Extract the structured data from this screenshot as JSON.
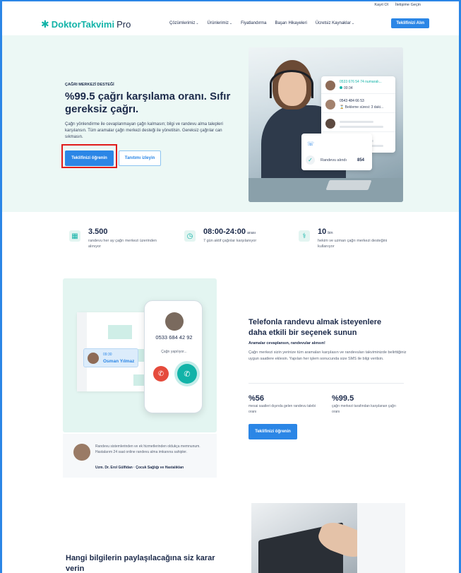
{
  "topbar": {
    "login": "Kayıt Ol",
    "contact": "İletişime Geçin"
  },
  "nav": {
    "logo_brand": "DoktorTakvimi",
    "logo_suffix": "Pro",
    "items": [
      {
        "label": "Çözümlerimiz",
        "dropdown": true
      },
      {
        "label": "Ürünlerimiz",
        "dropdown": true
      },
      {
        "label": "Fiyatlandırma",
        "dropdown": false
      },
      {
        "label": "Başarı Hikayeleri",
        "dropdown": false
      },
      {
        "label": "Ücretsiz Kaynaklar",
        "dropdown": true
      }
    ],
    "cta": "Teklifinizi Alın"
  },
  "hero": {
    "eyebrow": "ÇAĞRI MERKEZİ DESTEĞİ",
    "title": "%99.5 çağrı karşılama oranı. Sıfır gereksiz çağrı.",
    "description": "Çağrı yönlendirme ile cevaplanmayan çağrı kalmasın; bilgi ve randevu alma talepleri karşılansın. Tüm aramalar çağrı merkezi desteği ile yönetilsin. Gereksiz çağrılar can sıkmasın.",
    "primary_button": "Teklifinizi öğrenin",
    "secondary_button": "Tanıtımı izleyin",
    "call_card": {
      "row1_phone": "0533 676 54 74 numaralı...",
      "row1_timer": "00:34",
      "row2_phone": "0543 484 66 53",
      "row2_status": "Bekleme süresi: 3 daki..."
    },
    "mini_card": {
      "label": "Randevu alındı",
      "value": "854"
    }
  },
  "stats": [
    {
      "value": "3.500",
      "suffix": "",
      "desc": "randevu her ay çağrı merkezi üzerinden alınıyor",
      "icon": "calendar-icon"
    },
    {
      "value": "08:00-24:00",
      "suffix": "arası",
      "desc": "7 gün aktif çağrılar karşılanıyor",
      "icon": "clock-icon"
    },
    {
      "value": "10",
      "suffix": "bin",
      "desc": "hekim ve uzman çağrı merkezi desteğini kullanıyor",
      "icon": "doctor-icon"
    }
  ],
  "section2": {
    "phone_number": "0533 684 42 92",
    "phone_status": "Çağrı yapılıyor...",
    "caller_time": "09:30",
    "caller_name": "Osman Yılmaz",
    "title": "Telefonla randevu almak isteyenlere daha etkili bir seçenek sunun",
    "subtitle": "Aramalar cevaplansın, randevular alınsın!",
    "description": "Çağrı merkezi sizin yerinize tüm aramaları karşılasın ve randevuları takviminizde belirttiğiniz uygun saatlere eklesin. Yapılan her işlem sonucunda size SMS ile bilgi verilsin.",
    "stat1_value": "%56",
    "stat1_desc": "mesai saatleri dışında gelen randevu talebi oranı",
    "stat2_value": "%99.5",
    "stat2_desc": "çağrı merkezi tarafından karşılanan çağrı oranı",
    "button": "Teklifinizi öğrenin",
    "testimonial_quote": "Randevu sistemlerinden ve ek hizmetlerinden oldukça memnunum. Hastalarım 24 saat online randevu alma imkanına sahipler.",
    "testimonial_author": "Uzm. Dr. Erol Gülfidan · Çocuk Sağlığı ve Hastalıkları"
  },
  "section3": {
    "title": "Hangi bilgilerin paylaşılacağına siz karar verin"
  },
  "colors": {
    "accent": "#2b86e6",
    "brand": "#12b3a8",
    "hero_bg": "#ecf8f5",
    "highlight": "#e01b1b"
  }
}
